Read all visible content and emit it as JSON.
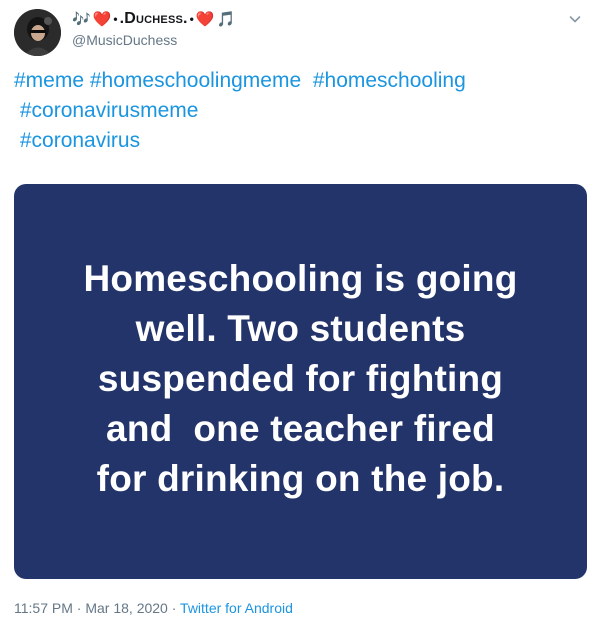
{
  "author": {
    "display_name": {
      "prefix_emoji": [
        "🎶",
        "❤️"
      ],
      "dot_left": "•",
      "name": ".Duchess.",
      "dot_right": "•",
      "suffix_emoji": [
        "❤️",
        "🎵"
      ]
    },
    "handle": "@MusicDuchess",
    "avatar_icon": "avatar-image"
  },
  "menu_icon": "chevron-down-icon",
  "tweet_text": {
    "lines": [
      [
        "#meme",
        " ",
        "#homeschoolingmeme",
        "  ",
        "#homeschooling"
      ],
      [
        " ",
        "#coronavirusmeme"
      ],
      [
        " ",
        "#coronavirus"
      ]
    ]
  },
  "media": {
    "background": "#23346b",
    "text_lines": [
      "Homeschooling is going",
      "well. Two students",
      "suspended for fighting",
      "and  one teacher fired",
      "for drinking on the job."
    ]
  },
  "meta": {
    "time": "11:57 PM",
    "separator": "·",
    "date": "Mar 18, 2020",
    "source": "Twitter for Android"
  },
  "colors": {
    "link": "#1b95e0",
    "secondary_text": "#657786",
    "primary_text": "#14171a"
  }
}
